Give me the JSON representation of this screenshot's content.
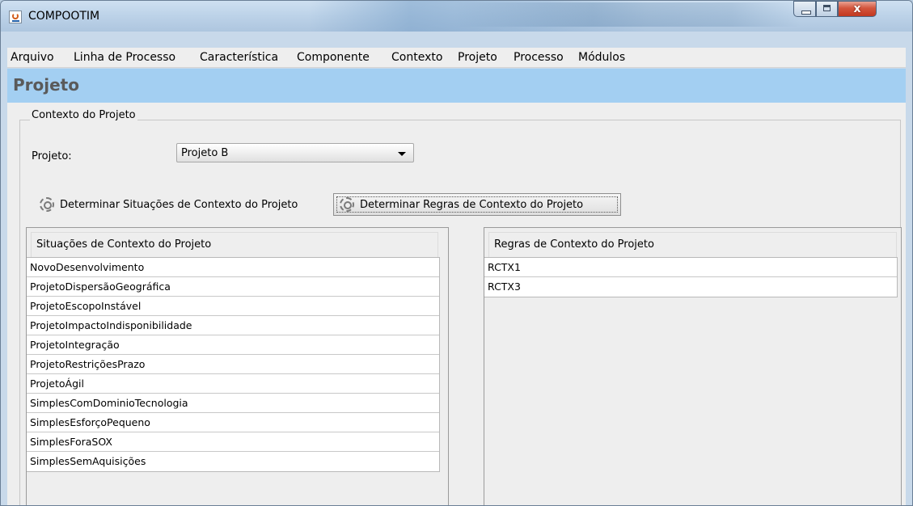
{
  "window": {
    "title": "COMPOOTIM"
  },
  "menu": [
    "Arquivo",
    "Linha de Processo",
    "Característica",
    "Componente",
    "Contexto",
    "Projeto",
    "Processo",
    "Módulos"
  ],
  "header": {
    "title": "Projeto"
  },
  "group": {
    "legend": "Contexto do Projeto"
  },
  "form": {
    "projeto_label": "Projeto:",
    "projeto_value": "Projeto B"
  },
  "buttons": {
    "situacoes": "Determinar Situações de Contexto do Projeto",
    "regras": "Determinar Regras de Contexto do Projeto"
  },
  "situacoes": {
    "header": "Situações de Contexto do Projeto",
    "rows": [
      "NovoDesenvolvimento",
      "ProjetoDispersãoGeográfica",
      "ProjetoEscopoInstável",
      "ProjetoImpactoIndisponibilidade",
      "ProjetoIntegração",
      "ProjetoRestriçõesPrazo",
      "ProjetoÁgil",
      "SimplesComDominioTecnologia",
      "SimplesEsforçoPequeno",
      "SimplesForaSOX",
      "SimplesSemAquisições"
    ]
  },
  "regras": {
    "header": "Regras de Contexto do Projeto",
    "rows": [
      "RCTX1",
      "RCTX3"
    ]
  },
  "icons": {
    "app": "java-app-icon",
    "action": "gear-icon"
  },
  "colors": {
    "header_bg": "#a3cff2",
    "title_bar": "#bcd2e8",
    "close_button": "#c8452c"
  }
}
